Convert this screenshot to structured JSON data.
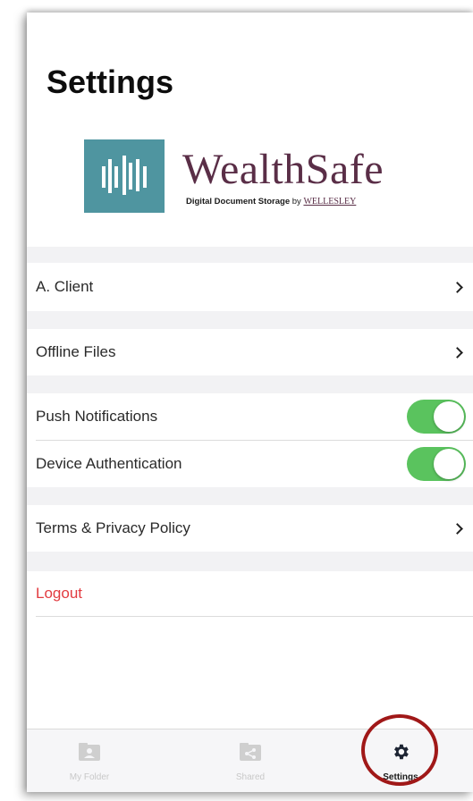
{
  "header": {
    "title": "Settings"
  },
  "logo": {
    "name": "WealthSafe",
    "tagline_strong": "Digital Document Storage",
    "tagline_by": "by",
    "tagline_brand": "WELLESLEY"
  },
  "settings": {
    "account": {
      "label": "A. Client"
    },
    "offline_files": {
      "label": "Offline Files"
    },
    "push_notifications": {
      "label": "Push Notifications",
      "enabled": true
    },
    "device_authentication": {
      "label": "Device Authentication",
      "enabled": true
    },
    "terms": {
      "label": "Terms & Privacy Policy"
    },
    "logout": {
      "label": "Logout"
    }
  },
  "tabbar": {
    "tabs": [
      {
        "label": "My Folder",
        "icon": "folder-person-icon",
        "active": false
      },
      {
        "label": "Shared",
        "icon": "shared-folder-icon",
        "active": false
      },
      {
        "label": "Settings",
        "icon": "gear-icon",
        "active": true
      }
    ]
  },
  "colors": {
    "accent_toggle": "#5ac35e",
    "logout": "#e23b40",
    "logo_teal": "#4f95a0",
    "logo_plum": "#5a2e47",
    "highlight_ring": "#a01818"
  }
}
